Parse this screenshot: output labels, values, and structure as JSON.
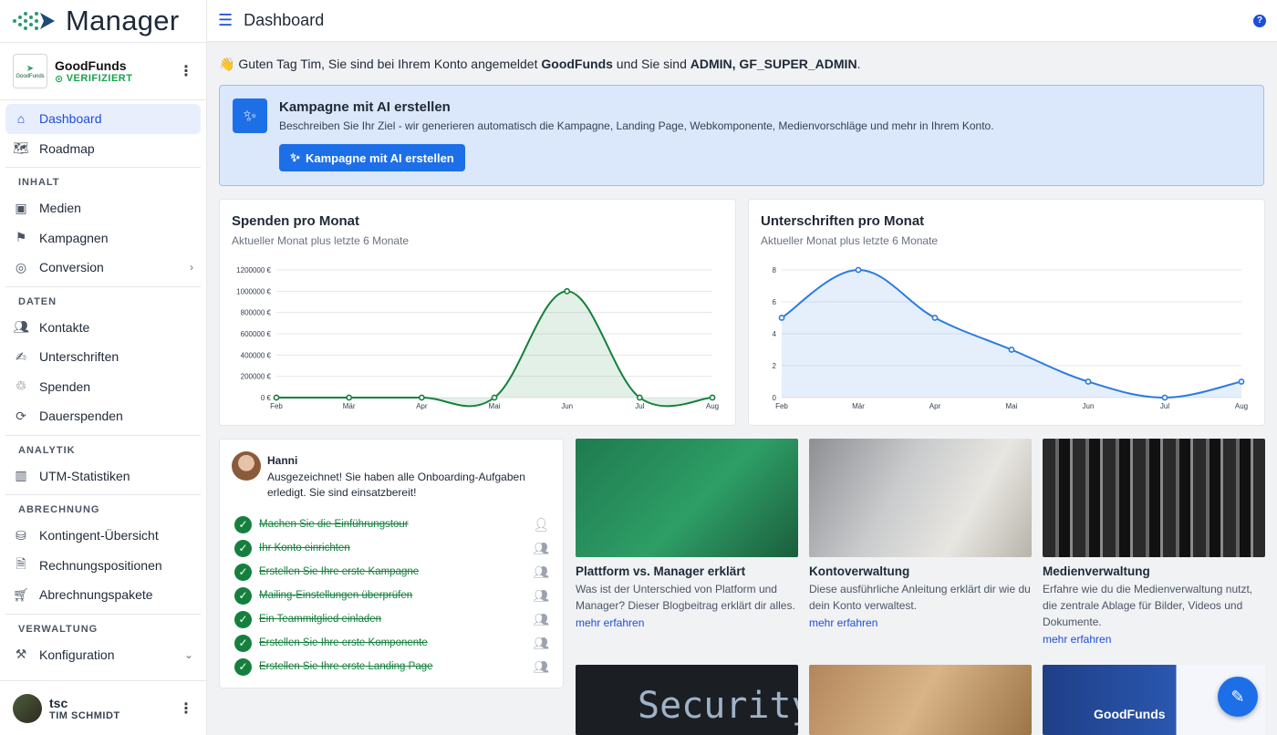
{
  "app": {
    "logo_text": "Manager"
  },
  "account": {
    "name": "GoodFunds",
    "status": "VERIFIZIERT",
    "logo_text": "GoodFunds"
  },
  "nav": {
    "dashboard": "Dashboard",
    "roadmap": "Roadmap",
    "section_inhalt": "INHALT",
    "medien": "Medien",
    "kampagnen": "Kampagnen",
    "conversion": "Conversion",
    "section_daten": "DATEN",
    "kontakte": "Kontakte",
    "unterschriften": "Unterschriften",
    "spenden": "Spenden",
    "dauerspenden": "Dauerspenden",
    "section_analytik": "ANALYTIK",
    "utm": "UTM-Statistiken",
    "section_abrechnung": "ABRECHNUNG",
    "kontingent": "Kontingent-Übersicht",
    "rechnungspositionen": "Rechnungspositionen",
    "abrechnungspakete": "Abrechnungspakete",
    "section_verwaltung": "VERWALTUNG",
    "konfiguration": "Konfiguration"
  },
  "user": {
    "short": "tsc",
    "full": "TIM SCHMIDT"
  },
  "header": {
    "title": "Dashboard"
  },
  "greeting": {
    "prefix": "👋 Guten Tag Tim, Sie sind bei Ihrem Konto angemeldet ",
    "org": "GoodFunds",
    "mid": " und Sie sind ",
    "roles": "ADMIN, GF_SUPER_ADMIN",
    "suffix": "."
  },
  "ai_banner": {
    "title": "Kampagne mit AI erstellen",
    "desc": "Beschreiben Sie Ihr Ziel - wir generieren automatisch die Kampagne, Landing Page, Webkomponente, Medienvorschläge und mehr in Ihrem Konto.",
    "button": "Kampagne mit AI erstellen"
  },
  "chart_data": [
    {
      "type": "area",
      "title": "Spenden pro Monat",
      "subtitle": "Aktueller Monat plus letzte 6 Monate",
      "categories": [
        "Feb",
        "Mär",
        "Apr",
        "Mai",
        "Jun",
        "Jul",
        "Aug"
      ],
      "values": [
        0,
        0,
        0,
        0,
        1000000,
        0,
        0
      ],
      "yticks": [
        "0 €",
        "200000 €",
        "400000 €",
        "600000 €",
        "800000 €",
        "1000000 €",
        "1200000 €"
      ],
      "ylim": [
        0,
        1200000
      ],
      "color": "#15803d"
    },
    {
      "type": "area",
      "title": "Unterschriften pro Monat",
      "subtitle": "Aktueller Monat plus letzte 6 Monate",
      "categories": [
        "Feb",
        "Mär",
        "Apr",
        "Mai",
        "Jun",
        "Jul",
        "Aug"
      ],
      "values": [
        5,
        8,
        5,
        3,
        1,
        0,
        1
      ],
      "yticks": [
        "0",
        "2",
        "4",
        "6",
        "8"
      ],
      "ylim": [
        0,
        8
      ],
      "color": "#2b7be0"
    }
  ],
  "onboarding": {
    "name": "Hanni",
    "message": "Ausgezeichnet! Sie haben alle Onboarding-Aufgaben erledigt. Sie sind einsatzbereit!",
    "tasks": [
      "Machen Sie die Einführungstour",
      "Ihr Konto einrichten",
      "Erstellen Sie Ihre erste Kampagne",
      "Mailing-Einstellungen überprüfen",
      "Ein Teammitglied einladen",
      "Erstellen Sie Ihre erste Komponente",
      "Erstellen Sie Ihre erste Landing Page"
    ]
  },
  "tiles": [
    {
      "title": "Plattform vs. Manager erklärt",
      "desc": "Was ist der Unterschied von Platform und Manager? Dieser Blogbeitrag erklärt dir alles.",
      "more": "mehr erfahren"
    },
    {
      "title": "Kontoverwaltung",
      "desc": "Diese ausführliche Anleitung erklärt dir wie du dein Konto verwaltest.",
      "more": "mehr erfahren"
    },
    {
      "title": "Medienverwaltung",
      "desc": "Erfahre wie du die Medienverwaltung nutzt, die zentrale Ablage für Bilder, Videos und Dokumente.",
      "more": "mehr erfahren"
    }
  ],
  "bottom_tiles": {
    "security_text": "Security",
    "goodfunds_text": "GoodFunds"
  }
}
